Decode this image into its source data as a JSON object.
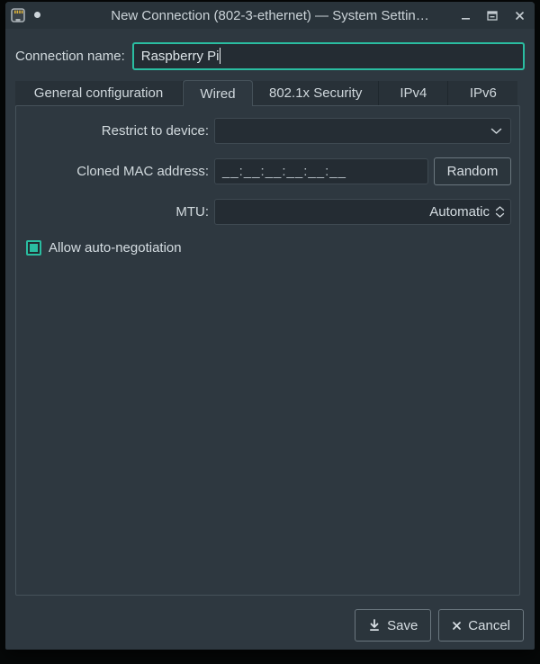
{
  "window": {
    "title": "New Connection (802-3-ethernet) — System Settin…",
    "icon": "ethernet-port-icon"
  },
  "form": {
    "connection_name": {
      "label": "Connection name:",
      "value": "Raspberry Pi"
    },
    "tabs": [
      {
        "label": "General configuration",
        "active": false
      },
      {
        "label": "Wired",
        "active": true
      },
      {
        "label": "802.1x Security",
        "active": false
      },
      {
        "label": "IPv4",
        "active": false
      },
      {
        "label": "IPv6",
        "active": false
      }
    ],
    "wired": {
      "restrict_label": "Restrict to device:",
      "restrict_value": "",
      "mac_label": "Cloned MAC address:",
      "mac_placeholder": "__:__:__:__:__:__",
      "random_button": "Random",
      "mtu_label": "MTU:",
      "mtu_value": "Automatic",
      "autoneg_label": "Allow auto-negotiation",
      "autoneg_checked": true
    }
  },
  "footer": {
    "save": "Save",
    "cancel": "Cancel"
  },
  "colors": {
    "accent": "#2abda1",
    "window_bg": "#2e3840",
    "titlebar_bg": "#29333a",
    "field_bg": "#242c33",
    "frame_border": "#46525a",
    "text": "#d5dde2"
  }
}
